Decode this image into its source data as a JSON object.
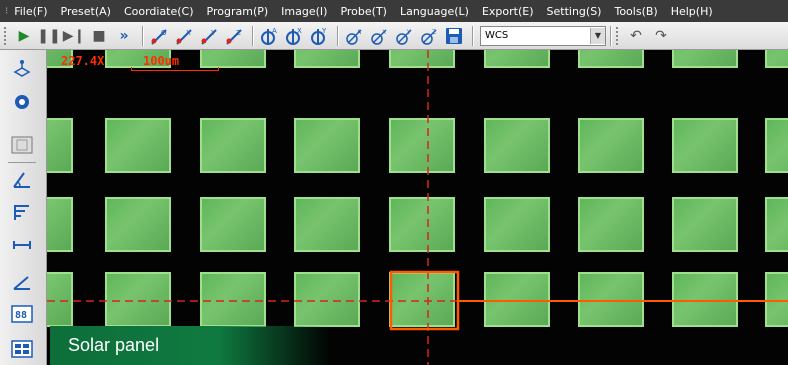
{
  "menu": {
    "items": [
      "File(F)",
      "Preset(A)",
      "Coordiate(C)",
      "Program(P)",
      "Image(I)",
      "Probe(T)",
      "Language(L)",
      "Export(E)",
      "Setting(S)",
      "Tools(B)",
      "Help(H)"
    ]
  },
  "toolbar": {
    "coord_system_value": "WCS",
    "icons": [
      "play-icon",
      "pause-icon",
      "step-icon",
      "stop-icon",
      "fast-forward-icon",
      "probe-origin-icon",
      "probe-x-icon",
      "probe-y-icon",
      "probe-z-icon",
      "rotate-a-icon",
      "rotate-x-icon",
      "rotate-y-icon",
      "probe2-a-icon",
      "probe2-x-icon",
      "probe2-y-icon",
      "probe2-z-icon",
      "save-icon",
      "undo-icon",
      "redo-icon"
    ]
  },
  "left_toolbar": {
    "icons": [
      "stage-icon",
      "light-icon",
      "image-frame-icon",
      "angle-measure-icon",
      "parallel-lines-icon",
      "distance-icon",
      "angle-icon",
      "grid-8x8-icon",
      "grid-view-icon"
    ]
  },
  "viewport": {
    "magnification": "227.4X",
    "scale_label": "100um",
    "overlay_color": "#ff2d00",
    "cell_color": "#6cbb63"
  },
  "caption": {
    "text": "Solar panel"
  }
}
